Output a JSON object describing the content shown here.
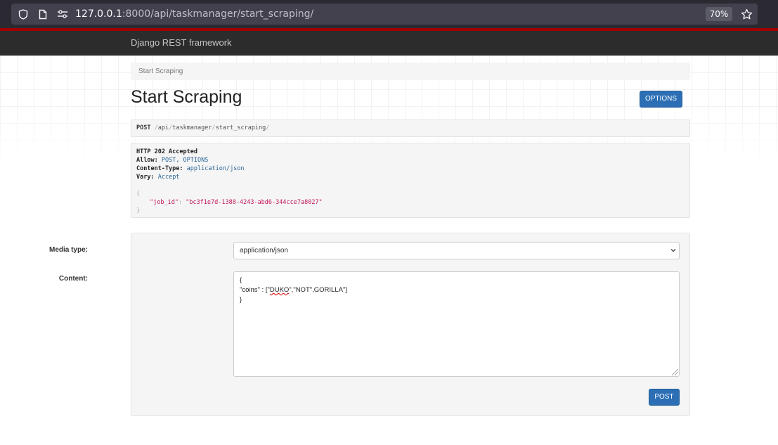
{
  "browser": {
    "url_host": "127.0.0.1",
    "url_rest": ":8000/api/taskmanager/start_scraping/",
    "zoom": "70%",
    "icons": [
      "shield-icon",
      "page-icon",
      "permissions-icon",
      "star-icon"
    ]
  },
  "navbar": {
    "brand": "Django REST framework",
    "accent_color": "#a30000"
  },
  "breadcrumb": {
    "label": "Start Scraping"
  },
  "page": {
    "title": "Start Scraping",
    "options_label": "OPTIONS"
  },
  "request": {
    "method": "POST",
    "path_parts": [
      "api",
      "taskmanager",
      "start_scraping"
    ]
  },
  "response": {
    "status": "HTTP 202 Accepted",
    "headers": [
      {
        "key": "Allow:",
        "value": "POST, OPTIONS"
      },
      {
        "key": "Content-Type:",
        "value": "application/json"
      },
      {
        "key": "Vary:",
        "value": "Accept"
      }
    ],
    "body_open": "{",
    "body_key": "\"job_id\"",
    "body_sep": ":",
    "body_value": "\"bc3f1e7d-1388-4243-abd6-344cce7a8027\"",
    "body_close": "}"
  },
  "form": {
    "media_type_label": "Media type:",
    "media_type_value": "application/json",
    "content_label": "Content:",
    "content_line1": "{",
    "content_line2_pre": "\"coins\" : [\"",
    "content_line2_flag": "DUKO",
    "content_line2_post": "\",\"NOT\",GORILLA\"]",
    "content_line3": "}",
    "submit_label": "POST",
    "button_color": "#2c6fb5"
  }
}
